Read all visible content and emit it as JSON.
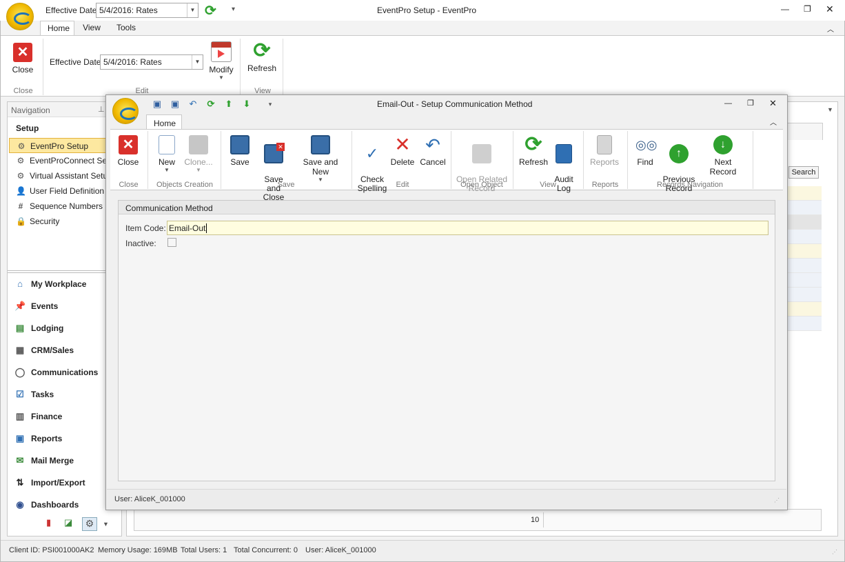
{
  "main_window": {
    "title": "EventPro Setup - EventPro",
    "qat": {
      "effective_date_label": "Effective Date",
      "effective_date_value": "5/4/2016: Rates"
    },
    "tabs": [
      "Home",
      "View",
      "Tools"
    ],
    "ribbon": {
      "close_label": "Close",
      "close_group": "Close",
      "effective_date_label": "Effective Date",
      "effective_date_value": "5/4/2016: Rates",
      "modify_label": "Modify",
      "edit_group": "Edit",
      "refresh_label": "Refresh",
      "view_group": "View"
    }
  },
  "navigation": {
    "header": "Navigation",
    "section": "Setup",
    "items": [
      {
        "label": "EventPro Setup",
        "icon": "gear-icon",
        "selected": true
      },
      {
        "label": "EventProConnect Setup",
        "icon": "gear-icon"
      },
      {
        "label": "Virtual Assistant Setup",
        "icon": "gear-icon"
      },
      {
        "label": "User Field Definition",
        "icon": "user-field-icon"
      },
      {
        "label": "Sequence Numbers",
        "icon": "hash-icon"
      },
      {
        "label": "Security",
        "icon": "lock-icon"
      }
    ],
    "modules": [
      {
        "label": "My Workplace",
        "icon": "house-icon"
      },
      {
        "label": "Events",
        "icon": "pin-icon"
      },
      {
        "label": "Lodging",
        "icon": "bed-icon"
      },
      {
        "label": "CRM/Sales",
        "icon": "contact-icon"
      },
      {
        "label": "Communications",
        "icon": "chat-icon"
      },
      {
        "label": "Tasks",
        "icon": "clipboard-icon"
      },
      {
        "label": "Finance",
        "icon": "ledger-icon"
      },
      {
        "label": "Reports",
        "icon": "report-icon"
      },
      {
        "label": "Mail Merge",
        "icon": "mail-merge-icon"
      },
      {
        "label": "Import/Export",
        "icon": "import-export-icon"
      },
      {
        "label": "Dashboards",
        "icon": "dashboard-icon"
      }
    ]
  },
  "background_grid": {
    "search_label": "Search",
    "page_count": "10"
  },
  "dialog": {
    "title": "Email-Out - Setup Communication Method",
    "tab": "Home",
    "groups": {
      "close": {
        "label": "Close",
        "buttons": [
          "Close"
        ]
      },
      "objects_creation": {
        "label": "Objects Creation",
        "buttons": [
          "New",
          "Clone..."
        ]
      },
      "save": {
        "label": "Save",
        "buttons": [
          "Save",
          "Save and\nClose",
          "Save and New"
        ]
      },
      "edit": {
        "label": "Edit",
        "buttons": [
          "Check\nSpelling",
          "Delete",
          "Cancel"
        ]
      },
      "open_object": {
        "label": "Open Object",
        "buttons": [
          "Open Related\nRecord"
        ]
      },
      "view": {
        "label": "View",
        "buttons": [
          "Refresh",
          "Audit\nLog"
        ]
      },
      "reports": {
        "label": "Reports",
        "buttons": [
          "Reports"
        ]
      },
      "records_navigation": {
        "label": "Records Navigation",
        "buttons": [
          "Find",
          "Previous\nRecord",
          "Next Record"
        ]
      }
    },
    "form": {
      "section_title": "Communication Method",
      "item_code_label": "Item Code:",
      "item_code_value": "Email-Out",
      "inactive_label": "Inactive:",
      "inactive_checked": false
    },
    "status": "User: AliceK_001000"
  },
  "statusbar": {
    "client_id": "Client ID: PSI001000AK2",
    "memory": "Memory Usage: 169MB",
    "total_users": "Total Users: 1",
    "total_concurrent": "Total Concurrent: 0",
    "user": "User: AliceK_001000"
  },
  "colors": {
    "accent_orange": "#e3b23c",
    "selected_bg": "#fde8a0",
    "red": "#d9302b",
    "green": "#2fa12f",
    "input_highlight": "#fffde0"
  }
}
